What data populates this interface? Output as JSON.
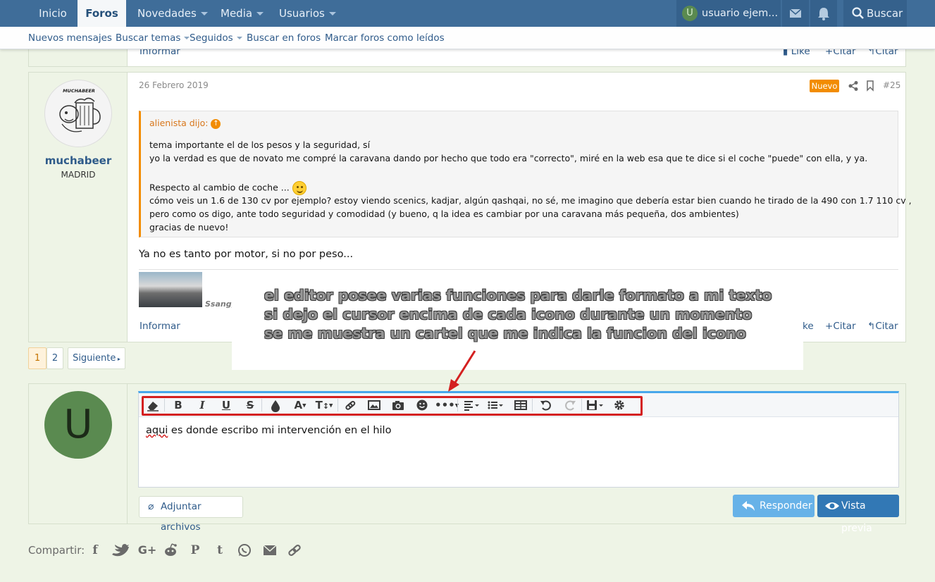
{
  "topnav": {
    "items": [
      {
        "label": "Inicio"
      },
      {
        "label": "Foros"
      },
      {
        "label": "Novedades"
      },
      {
        "label": "Media"
      },
      {
        "label": "Usuarios"
      }
    ],
    "user_initial": "U",
    "user_name": "usuario ejem...",
    "search_label": "Buscar"
  },
  "subnav": {
    "items": [
      {
        "label": "Nuevos mensajes"
      },
      {
        "label": "Buscar temas"
      },
      {
        "label": "Seguidos"
      },
      {
        "label": "Buscar en foros"
      },
      {
        "label": "Marcar foros como leídos"
      }
    ]
  },
  "prev_post": {
    "report": "Informar",
    "like": "Like",
    "quote1": "Citar",
    "quote2": "Citar"
  },
  "post": {
    "username": "muchabeer",
    "location": "MADRID",
    "avatar_text": "MUCHABEER",
    "date": "26 Febrero 2019",
    "badge": "Nuevo",
    "number": "#25",
    "quote": {
      "author": "alienista dijo:",
      "lines": [
        "tema importante el de los pesos y la seguridad, sí",
        "yo la verdad es que de novato me compré la caravana dando por hecho que todo era \"correcto\", miré en la web esa que te dice si el coche \"puede\" con ella, y ya.",
        "Respecto al cambio de coche ...",
        "cómo veis un 1.6 de 130 cv por ejemplo? estoy viendo scenics, kadjar, algún qashqai, no sé, me imagino que debería estar bien cuando he tirado de la 490 con 1.7 110 cv ,",
        "pero como os digo, ante todo seguridad y comodidad (y bueno, q la idea es cambiar por una caravana más pequeña, dos ambientes)",
        "gracias de nuevo!"
      ]
    },
    "body": "Ya no es tanto por motor, si no por peso...",
    "attachment_label": "Ssangy",
    "report": "Informar",
    "like": "ke",
    "quote1": "Citar",
    "quote2": "Citar"
  },
  "pagination": {
    "pages": [
      "1",
      "2"
    ],
    "next": "Siguiente"
  },
  "annotation": {
    "lines": [
      "el editor posee varias funciones para darle formato a mi texto",
      "si dejo el cursor encima de cada icono durante un momento",
      "se me muestra un cartel que me indica la funcion del icono"
    ]
  },
  "reply": {
    "avatar_initial": "U",
    "editor_word1": "aqui",
    "editor_text": " es donde escribo mi intervención en el hilo",
    "attach_label": "Adjuntar archivos",
    "reply_label": "Responder",
    "preview_label": "Vista previa"
  },
  "share": {
    "label": "Compartir:",
    "icons": [
      "facebook-icon",
      "twitter-icon",
      "google-plus-icon",
      "reddit-icon",
      "pinterest-icon",
      "tumblr-icon",
      "whatsapp-icon",
      "email-icon",
      "link-icon"
    ]
  },
  "colors": {
    "nav": "#3f6d99",
    "accent": "#f28c00",
    "highlight": "#d42020",
    "page_bg": "#eef4e6"
  }
}
